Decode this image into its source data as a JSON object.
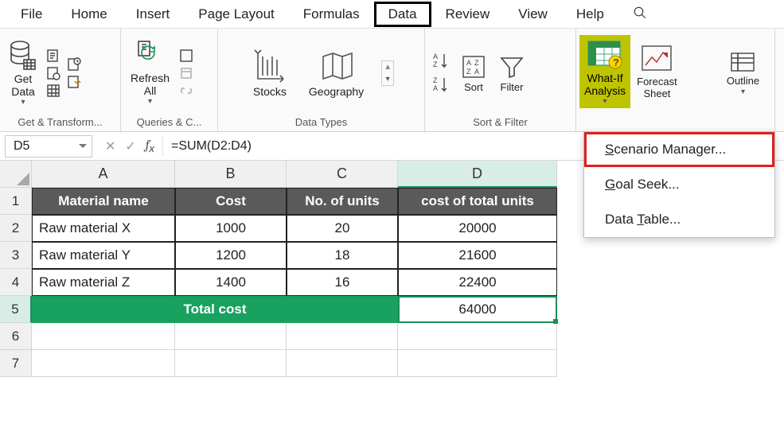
{
  "tabs": {
    "file": "File",
    "home": "Home",
    "insert": "Insert",
    "page_layout": "Page Layout",
    "formulas": "Formulas",
    "data": "Data",
    "review": "Review",
    "view": "View",
    "help": "Help"
  },
  "ribbon": {
    "get_transform": {
      "label": "Get & Transform...",
      "get_data": "Get\nData"
    },
    "queries": {
      "label": "Queries & C...",
      "refresh": "Refresh\nAll"
    },
    "data_types": {
      "label": "Data Types",
      "stocks": "Stocks",
      "geography": "Geography"
    },
    "sort_filter": {
      "label": "Sort & Filter",
      "sort": "Sort",
      "filter": "Filter"
    },
    "forecast": {
      "whatif": "What-If\nAnalysis",
      "forecast_sheet": "Forecast\nSheet"
    },
    "outline": {
      "label": "Outline"
    }
  },
  "menu": {
    "scenario": "Scenario Manager...",
    "goal": "Goal Seek...",
    "table": "Data Table..."
  },
  "fbar": {
    "name": "D5",
    "formula": "=SUM(D2:D4)"
  },
  "cols": [
    "A",
    "B",
    "C",
    "D"
  ],
  "headers": {
    "a": "Material name",
    "b": "Cost",
    "c": "No. of units",
    "d": "cost of total units"
  },
  "rows": [
    {
      "a": "Raw material X",
      "b": "1000",
      "c": "20",
      "d": "20000"
    },
    {
      "a": "Raw material Y",
      "b": "1200",
      "c": "18",
      "d": "21600"
    },
    {
      "a": "Raw material Z",
      "b": "1400",
      "c": "16",
      "d": "22400"
    }
  ],
  "total": {
    "label": "Total cost",
    "value": "64000"
  }
}
